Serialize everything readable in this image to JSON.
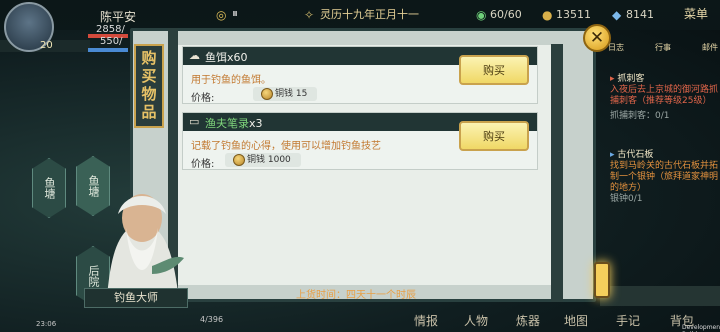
{
  "player": {
    "name": "陈平安",
    "level": "20",
    "hp": "2858/",
    "mp": "550/"
  },
  "top": {
    "date": "灵历十九年正月十一",
    "energy": "60/60",
    "coins": "13511",
    "gems": "8141",
    "menu": "菜单"
  },
  "left_nodes": [
    "鱼塘",
    "鱼塘",
    "后院"
  ],
  "quests": {
    "header_icons": [
      "日志",
      "行事",
      "邮件"
    ],
    "q1_title": "抓刺客",
    "q1_desc": "入夜后去上京城的御河路抓捕刺客（推荐等级25级）",
    "q1_progress": "抓捕刺客：0/1",
    "q2_title": "古代石板",
    "q2_desc": "找到马岭关的古代石板并拓制一个银钟（旅拜道家神明的地方）",
    "q2_progress": "银钟0/1"
  },
  "dialog": {
    "title": "购买物品",
    "items": [
      {
        "icon": "fish-bait-icon",
        "name": "鱼饵x60",
        "desc": "用于钓鱼的鱼饵。",
        "price_label": "价格:",
        "price": "铜钱 15",
        "buy": "购买"
      },
      {
        "icon": "book-icon",
        "name_hl": "渔夫笔录",
        "name_suffix": "x3",
        "desc": "记载了钓鱼的心得，使用可以增加钓鱼技艺",
        "price_label": "价格:",
        "price": "铜钱 1000",
        "buy": "购买"
      }
    ],
    "restock_label": "上货时间：",
    "restock_value": "四天十一个时辰",
    "close": "✕"
  },
  "npc": {
    "name": "钓鱼大师"
  },
  "bottom_nav": [
    "情报",
    "人物",
    "炼器",
    "地图",
    "手记",
    "背包"
  ],
  "status": {
    "clock": "23:06",
    "progress": "4/396",
    "build": "Development Build"
  },
  "colors": {
    "gold": "#e7c267",
    "panel": "#213534",
    "desc_orange": "#c2782f",
    "button": "#f0d866"
  }
}
